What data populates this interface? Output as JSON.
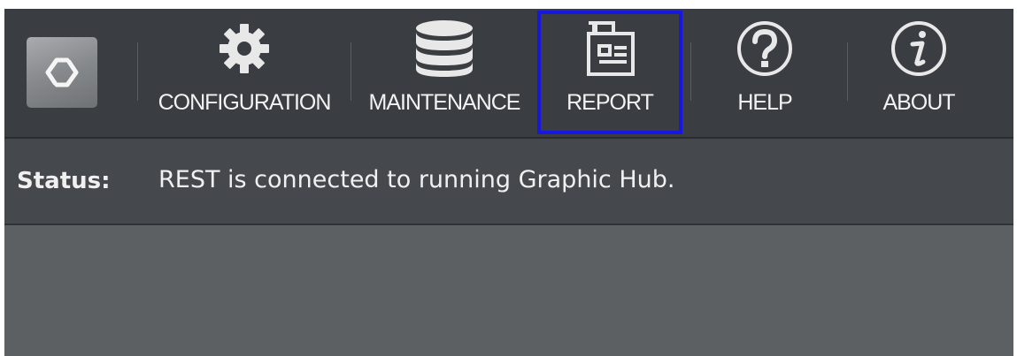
{
  "toolbar": {
    "logo_icon": "app-logo-icon",
    "items": [
      {
        "key": "configuration",
        "label": "CONFIGURATION",
        "icon": "gear-icon"
      },
      {
        "key": "maintenance",
        "label": "MAINTENANCE",
        "icon": "database-icon"
      },
      {
        "key": "report",
        "label": "REPORT",
        "icon": "report-icon",
        "highlighted": true
      },
      {
        "key": "help",
        "label": "HELP",
        "icon": "help-circle-icon"
      },
      {
        "key": "about",
        "label": "ABOUT",
        "icon": "info-circle-icon"
      }
    ]
  },
  "status": {
    "label": "Status:",
    "message": "REST is connected to running Graphic Hub."
  },
  "colors": {
    "toolbar_bg": "#3a3d41",
    "status_bg": "#45484c",
    "content_bg": "#5d6063",
    "highlight": "#1717e0",
    "text": "#f2f2f2"
  }
}
